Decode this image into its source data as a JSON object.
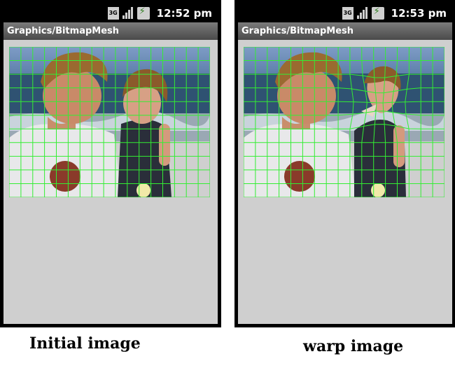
{
  "left_phone": {
    "status": {
      "network": "3G",
      "time": "12:52 pm"
    },
    "app_title": "Graphics/BitmapMesh",
    "caption": "Initial image"
  },
  "right_phone": {
    "status": {
      "network": "3G",
      "time": "12:53 pm"
    },
    "app_title": "Graphics/BitmapMesh",
    "caption": "warp image"
  },
  "colors": {
    "mesh": "#33ee33",
    "screen_bg": "#cfcfcf",
    "titlebar": "#5e5e5e",
    "sky": "#6f8fbd",
    "sea": "#2f5272"
  },
  "icons": [
    "3g-icon",
    "signal-icon",
    "battery-charging-icon"
  ]
}
